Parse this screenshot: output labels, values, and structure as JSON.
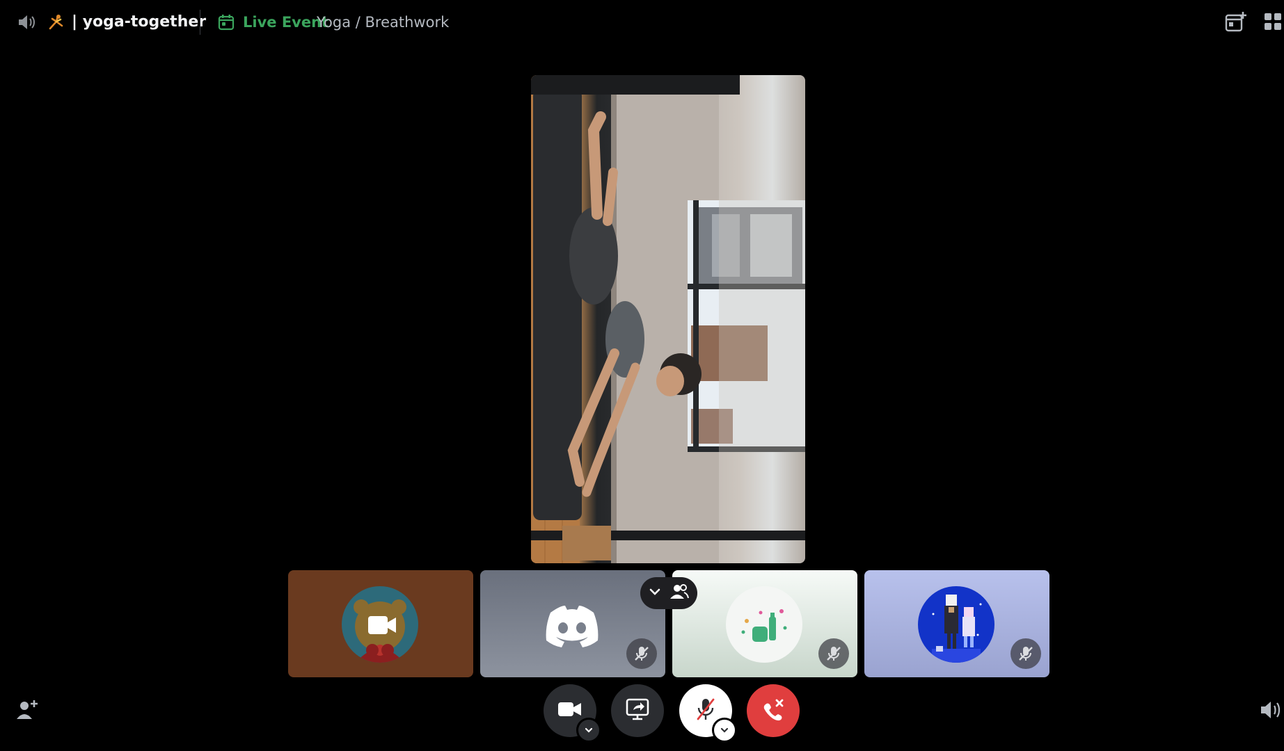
{
  "header": {
    "channel_name": "| yoga-together",
    "channel_emoji": "person-doing-cartwheel emoji",
    "live_event_label": "Live Event",
    "event_name": "Yoga / Breathwork",
    "icons": [
      "speaker-icon",
      "calendar-icon",
      "add-event-icon",
      "grid-layout-icon"
    ]
  },
  "main_stream": {
    "description_icon": "video-stream",
    "accent": "#3ba55d"
  },
  "participants": [
    {
      "avatar": "bear-avatar",
      "video_on": true,
      "muted": false
    },
    {
      "avatar": "discord-logo-avatar",
      "video_on": false,
      "muted": true
    },
    {
      "avatar": "sparkle-bottle-avatar",
      "video_on": false,
      "muted": true
    },
    {
      "avatar": "pixel-characters-avatar",
      "video_on": false,
      "muted": true
    }
  ],
  "controls": {
    "camera": "camera-icon",
    "screen_share": "screen-share-icon",
    "microphone": "microphone-muted-icon",
    "leave": "hang-up-icon",
    "invite": "add-friend-icon",
    "volume": "volume-icon"
  },
  "colors": {
    "background": "#000000",
    "live_green": "#3ba55d",
    "leave_red": "#e03e3e",
    "control_dark": "#2b2d31"
  }
}
